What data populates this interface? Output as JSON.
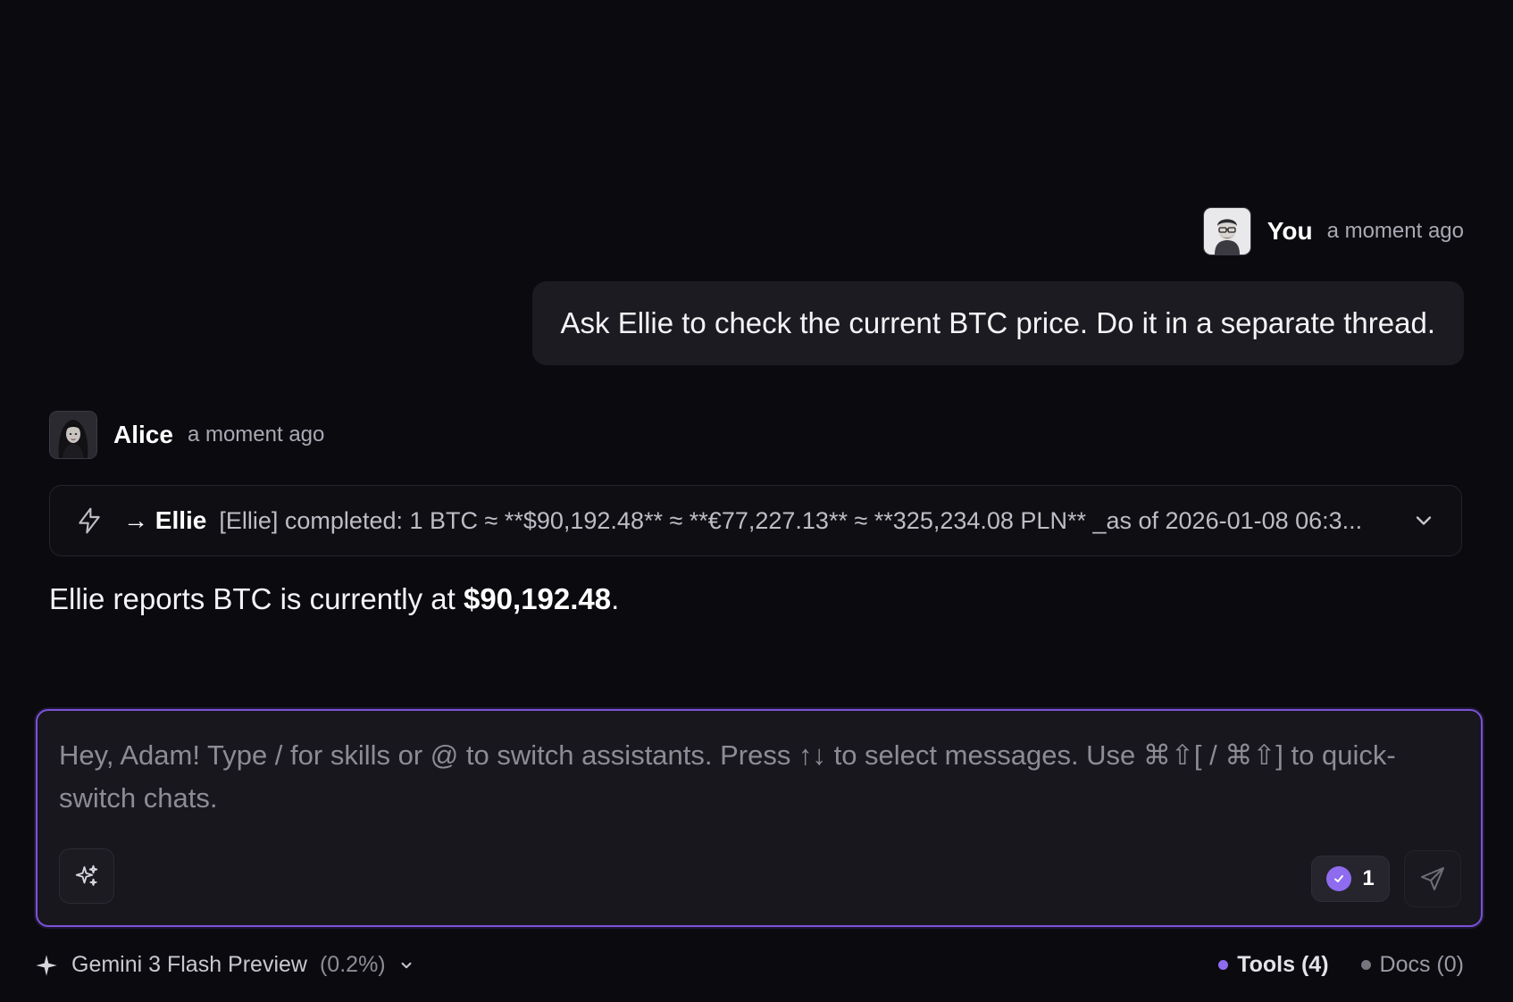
{
  "user_message": {
    "author": "You",
    "time": "a moment ago",
    "text": "Ask Ellie to check the current BTC price. Do it in a separate thread."
  },
  "assistant_message": {
    "author": "Alice",
    "time": "a moment ago",
    "tool_call": {
      "icon": "bolt-icon",
      "target": "→ Ellie",
      "summary": "[Ellie] completed: 1 BTC ≈ **$90,192.48** ≈ **€77,227.13** ≈ **325,234.08 PLN** _as of 2026-01-08 06:3..."
    },
    "text_before": "Ellie reports BTC is currently at ",
    "text_bold": "$90,192.48",
    "text_after": "."
  },
  "composer": {
    "placeholder": "Hey, Adam! Type / for skills or @ to switch assistants. Press ↑↓ to select messages. Use ⌘⇧[ / ⌘⇧] to quick-switch chats.",
    "approval_count": "1",
    "accent_color": "#7b52d8"
  },
  "footer": {
    "model_name": "Gemini 3 Flash Preview",
    "model_usage": "(0.2%)",
    "tools_label": "Tools (4)",
    "tools_dot_color": "#8f6bf0",
    "docs_label": "Docs (0)",
    "docs_dot_color": "#77767f"
  }
}
